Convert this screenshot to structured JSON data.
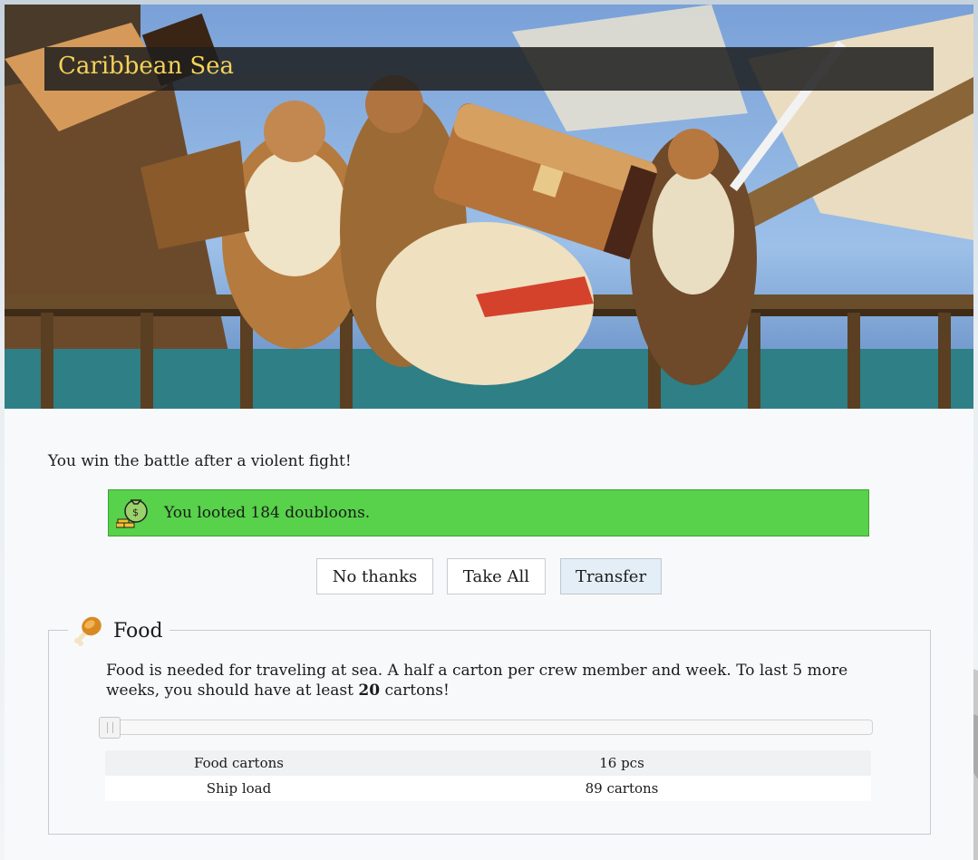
{
  "header": {
    "title": "Caribbean Sea"
  },
  "battle": {
    "message": "You win the battle after a violent fight!",
    "loot_text": "You looted 184 doubloons.",
    "loot_icon": "money-bag-gold-icon"
  },
  "actions": {
    "no_thanks": "No thanks",
    "take_all": "Take All",
    "transfer": "Transfer"
  },
  "food": {
    "legend": "Food",
    "icon": "chicken-leg-icon",
    "desc_before": "Food is needed for traveling at sea. A half a carton per crew member and week. To last 5 more weeks, you should have at least ",
    "desc_bold": "20",
    "desc_after": " cartons!",
    "slider_value_fraction": 0,
    "rows": [
      {
        "label": "Food cartons",
        "value": "16 pcs"
      },
      {
        "label": "Ship load",
        "value": "89 cartons"
      }
    ]
  },
  "colors": {
    "title_text": "#f4d25a",
    "loot_bg": "#57d24a",
    "panel_bg": "#f7f9fb"
  }
}
